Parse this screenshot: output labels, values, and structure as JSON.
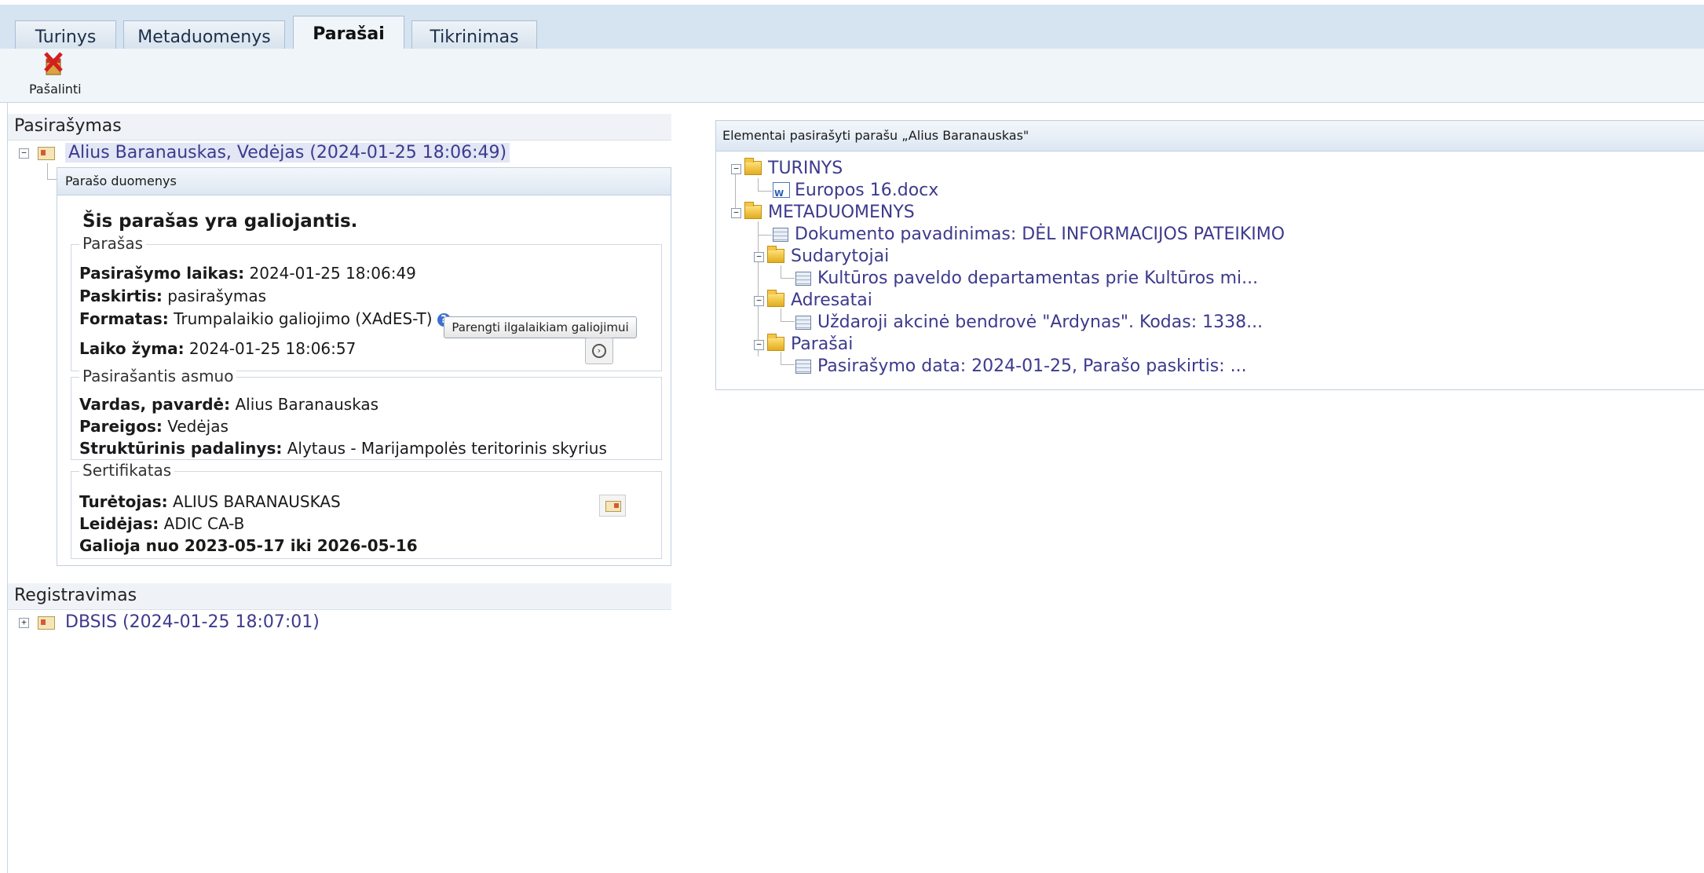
{
  "tabs": [
    {
      "label": "Turinys",
      "active": false
    },
    {
      "label": "Metaduomenys",
      "active": false
    },
    {
      "label": "Parašai",
      "active": true
    },
    {
      "label": "Tikrinimas",
      "active": false
    }
  ],
  "toolbar": {
    "remove_label": "Pašalinti"
  },
  "signing": {
    "section_title": "Pasirašymas",
    "signature_entry": "Alius Baranauskas, Vedėjas (2024-01-25 18:06:49)",
    "panel_title": "Parašo duomenys",
    "validity": "Šis parašas yra galiojantis.",
    "signature_group": {
      "legend": "Parašas",
      "time_label": "Pasirašymo laikas:",
      "time_value": " 2024-01-25 18:06:49",
      "purpose_label": "Paskirtis:",
      "purpose_value": " pasirašymas",
      "format_label": "Formatas:",
      "format_value": " Trumpalaikio galiojimo (XAdES-T)",
      "prepare_button": "Parengti ilgalaikiam galiojimui",
      "timestamp_label": "Laiko žyma:",
      "timestamp_value": " 2024-01-25 18:06:57"
    },
    "signer_group": {
      "legend": "Pasirašantis asmuo",
      "name_label": "Vardas, pavardė:",
      "name_value": " Alius Baranauskas",
      "position_label": "Pareigos:",
      "position_value": " Vedėjas",
      "unit_label": "Struktūrinis padalinys:",
      "unit_value": " Alytaus - Marijampolės teritorinis skyrius"
    },
    "cert_group": {
      "legend": "Sertifikatas",
      "holder_label": "Turėtojas:",
      "holder_value": " ALIUS BARANAUSKAS",
      "issuer_label": "Leidėjas:",
      "issuer_value": " ADIC CA-B",
      "validity_text": "Galioja nuo 2023-05-17 iki 2026-05-16"
    }
  },
  "registration": {
    "section_title": "Registravimas",
    "entry": "DBSIS (2024-01-25 18:07:01)"
  },
  "signed_elements": {
    "title": "Elementai pasirašyti parašu „Alius Baranauskas\"",
    "tree": {
      "turinys": "TURINYS",
      "file": "Europos 16.docx",
      "metaduomenys": "METADUOMENYS",
      "doc_title": "Dokumento pavadinimas: DĖL INFORMACIJOS PATEIKIMO",
      "sudarytojai": "Sudarytojai",
      "sudarytojai_item": "Kultūros paveldo departamentas prie Kultūros mi...",
      "adresatai": "Adresatai",
      "adresatai_item": "Uždaroji akcinė bendrovė \"Ardynas\". Kodas: 1338...",
      "parasai": "Parašai",
      "parasai_item": "Pasirašymo data: 2024-01-25, Parašo paskirtis: ..."
    }
  }
}
